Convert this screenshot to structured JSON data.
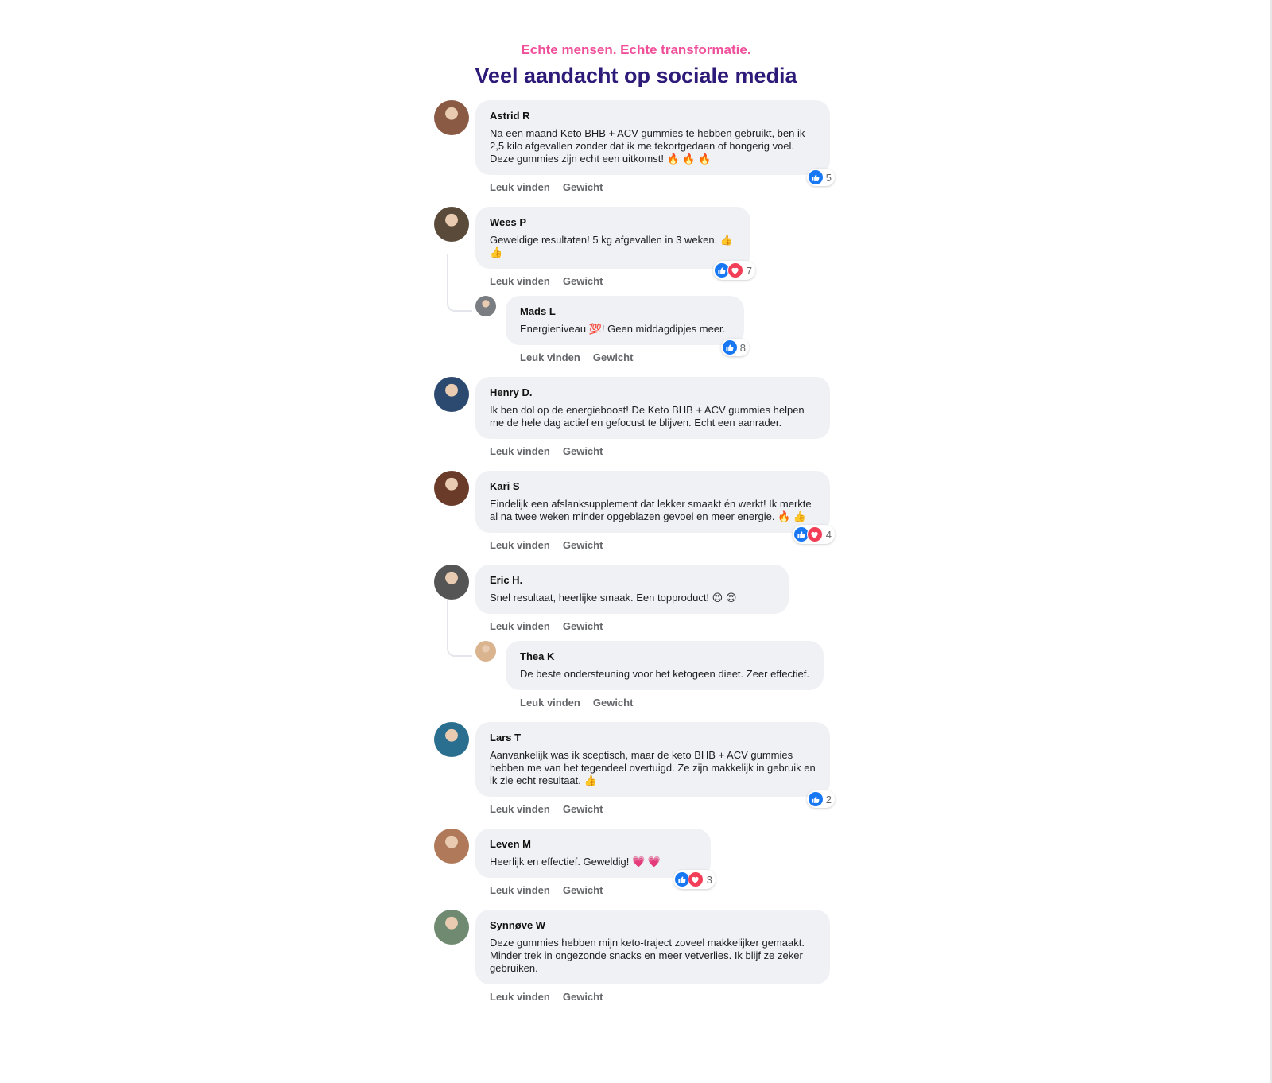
{
  "header": {
    "kicker": "Echte mensen. Echte transformatie.",
    "title": "Veel aandacht op sociale media"
  },
  "actions": {
    "like": "Leuk vinden",
    "weight": "Gewicht"
  },
  "comments": [
    {
      "author": "Astrid R",
      "text": "Na een maand Keto BHB + ACV gummies te hebben gebruikt, ben ik 2,5 kilo afgevallen zonder dat ik me tekortgedaan of hongerig voel. Deze gummies zijn echt een uitkomst! 🔥 🔥 🔥",
      "reactions": [
        "like"
      ],
      "count": "5",
      "avatar_color": "#8a5a44"
    },
    {
      "author": "Wees P",
      "text": "Geweldige resultaten! 5 kg afgevallen in 3 weken. 👍 👍",
      "reactions": [
        "like",
        "love"
      ],
      "count": "7",
      "avatar_color": "#5a4a3a",
      "replies": [
        {
          "author": "Mads L",
          "text": "Energieniveau 💯! Geen middagdipjes meer.",
          "reactions": [
            "like"
          ],
          "count": "8",
          "avatar_color": "#7a7d82"
        }
      ]
    },
    {
      "author": "Henry D.",
      "text": "Ik ben dol op de energieboost! De Keto BHB + ACV gummies helpen me de hele dag actief en gefocust te blijven. Echt een aanrader.",
      "avatar_color": "#2c4a70"
    },
    {
      "author": "Kari S",
      "text": "Eindelijk een afslanksupplement dat lekker smaakt én werkt! Ik merkte al na twee weken minder opgeblazen gevoel en meer energie. 🔥 👍",
      "reactions": [
        "like",
        "love"
      ],
      "count": "4",
      "avatar_color": "#6b3b2a"
    },
    {
      "author": "Eric H.",
      "text": "Snel resultaat, heerlijke smaak. Een topproduct! 😍 😍",
      "avatar_color": "#555555",
      "replies": [
        {
          "author": "Thea K",
          "text": "De beste ondersteuning voor het ketogeen dieet. Zeer effectief.",
          "avatar_color": "#d9b48f"
        }
      ]
    },
    {
      "author": "Lars T",
      "text": "Aanvankelijk was ik sceptisch, maar de keto BHB + ACV gummies hebben me van het tegendeel overtuigd. Ze zijn makkelijk in gebruik en ik zie echt resultaat. 👍",
      "reactions": [
        "like"
      ],
      "count": "2",
      "avatar_color": "#2a6f8f"
    },
    {
      "author": "Leven M",
      "text": "Heerlijk en effectief. Geweldig! 💗 💗",
      "reactions": [
        "like",
        "love"
      ],
      "count": "3",
      "avatar_color": "#b07a5a"
    },
    {
      "author": "Synnøve W",
      "text": "Deze gummies hebben mijn keto-traject zoveel makkelijker gemaakt. Minder trek in ongezonde snacks en meer vetverlies. Ik blijf ze zeker gebruiken.",
      "avatar_color": "#6f8a70"
    }
  ],
  "colors": {
    "kicker": "#f0509a",
    "title": "#2e1a78",
    "bubble": "#f0f1f4",
    "like": "#1877f2",
    "love": "#f33e58"
  }
}
